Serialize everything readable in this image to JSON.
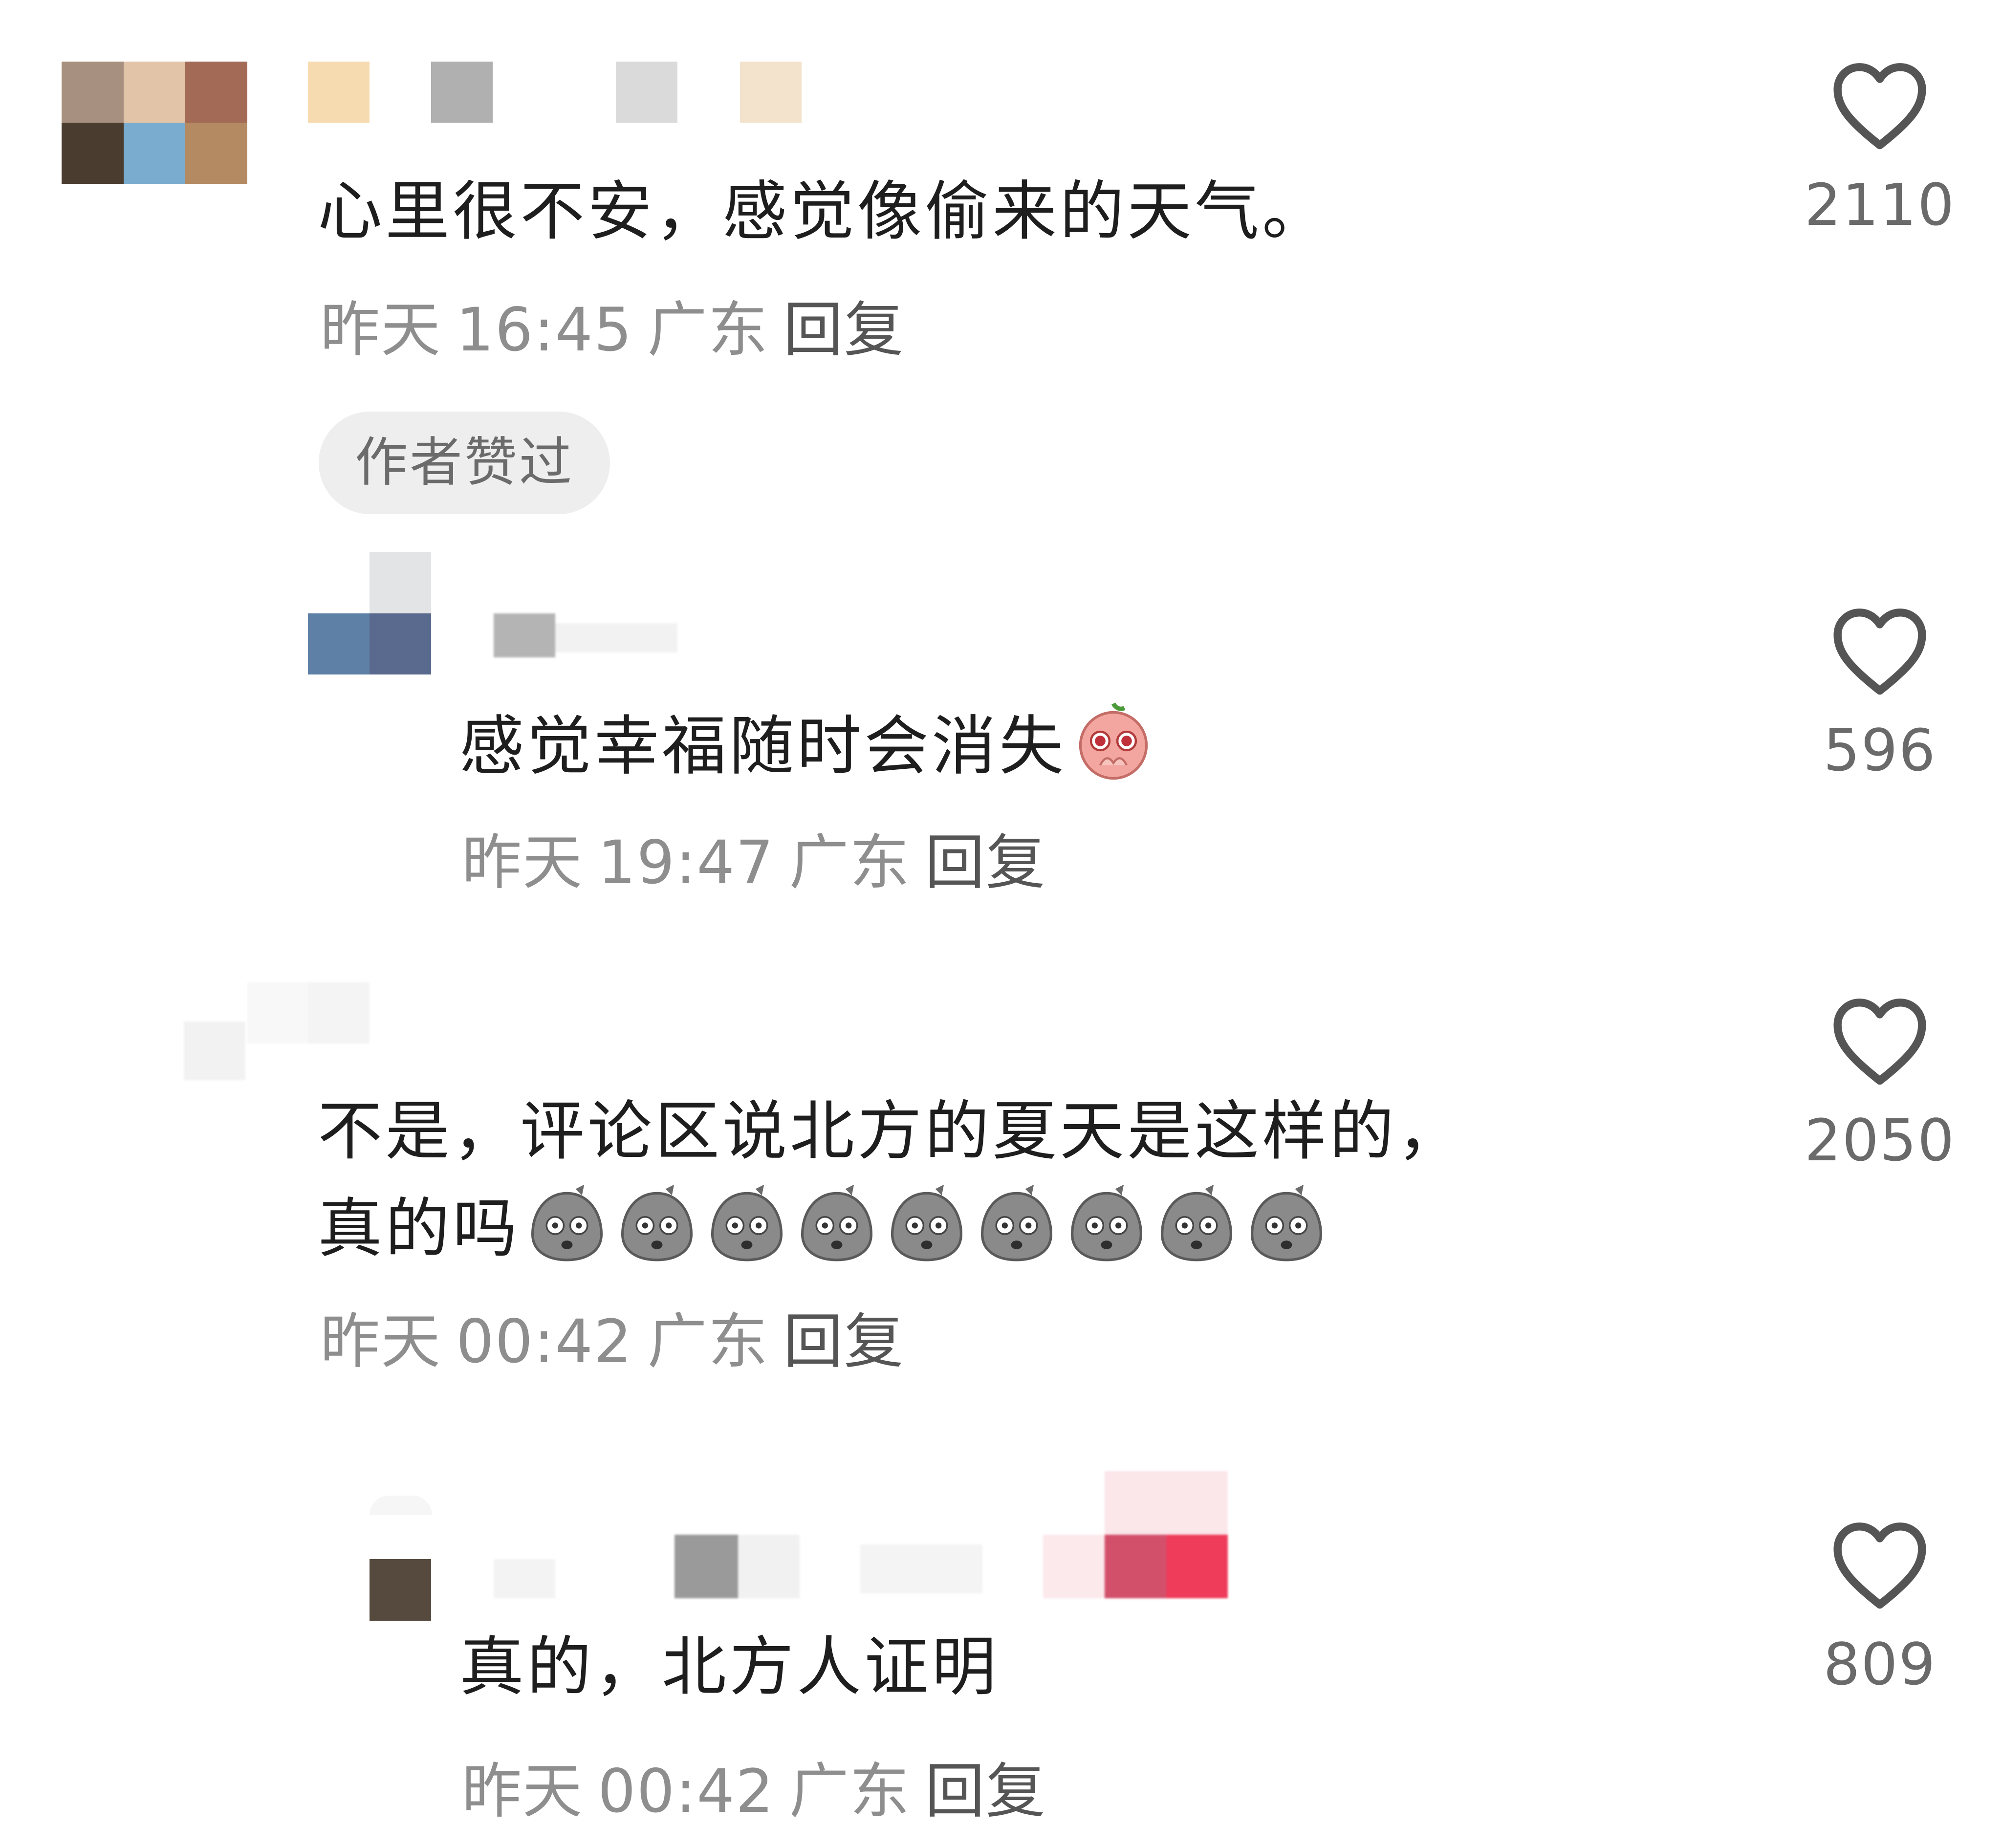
{
  "comments": [
    {
      "text": "心里很不安，感觉像偷来的天气。",
      "day": "昨天",
      "time": "16:45",
      "location": "广东",
      "reply_label": "回复",
      "badge": "作者赞过",
      "likes": "2110"
    },
    {
      "text": "感觉幸福随时会消失",
      "emoji": "pleading-peach-emoji",
      "day": "昨天",
      "time": "19:47",
      "location": "广东",
      "reply_label": "回复",
      "likes": "596"
    },
    {
      "text_line1": "不是，评论区说北方的夏天是这样的，",
      "text_line2": "真的吗",
      "emoji": "shocked-grey-bag-emoji",
      "emoji_count": 9,
      "day": "昨天",
      "time": "00:42",
      "location": "广东",
      "reply_label": "回复",
      "likes": "2050"
    },
    {
      "text": "真的，北方人证明",
      "day": "昨天",
      "time": "00:42",
      "location": "广东",
      "reply_label": "回复",
      "likes": "809"
    }
  ],
  "icons": {
    "like": "heart-outline-icon"
  },
  "colors": {
    "text": "#1e1e1e",
    "meta": "#8e8e8e",
    "reply": "#555555",
    "badge_bg": "#eeeeee",
    "heart": "#555555"
  }
}
